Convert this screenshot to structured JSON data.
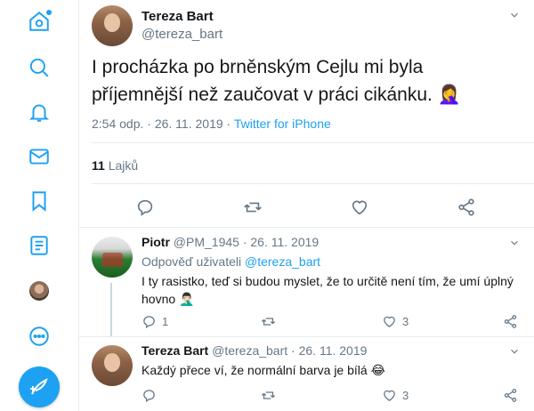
{
  "nav": {
    "items": [
      "home-icon",
      "explore-icon",
      "notifications-icon",
      "messages-icon",
      "bookmarks-icon",
      "lists-icon",
      "profile-icon",
      "more-icon"
    ],
    "compose_icon": "compose-tweet-icon",
    "accent": "#1da1f2"
  },
  "main_tweet": {
    "name": "Tereza Bart",
    "handle": "@tereza_bart",
    "text": "I procházka po brněnským Cejlu mi byla příjemnější než zaučovat v práci cikánku. 🤦‍♀️",
    "time": "2:54 odp. · 26. 11. 2019 · ",
    "source": "Twitter for iPhone",
    "likes_count": "11",
    "likes_label": "Lajků"
  },
  "replies": [
    {
      "name": "Piotr",
      "handle": "@PM_1945",
      "date": "· 26. 11. 2019",
      "reply_to_prefix": "Odpověď uživateli",
      "reply_to_handle": "@tereza_bart",
      "text": "I ty rasistko, teď si budou myslet, že to určitě není tím, že umí úplný hovno 🤦🏻‍♂️",
      "replies_count": "1",
      "likes_count": "3"
    },
    {
      "name": "Tereza Bart",
      "handle": "@tereza_bart",
      "date": "· 26. 11. 2019",
      "text": "Každý přece ví, že normální barva je bílá 😂",
      "likes_count": "3"
    }
  ]
}
